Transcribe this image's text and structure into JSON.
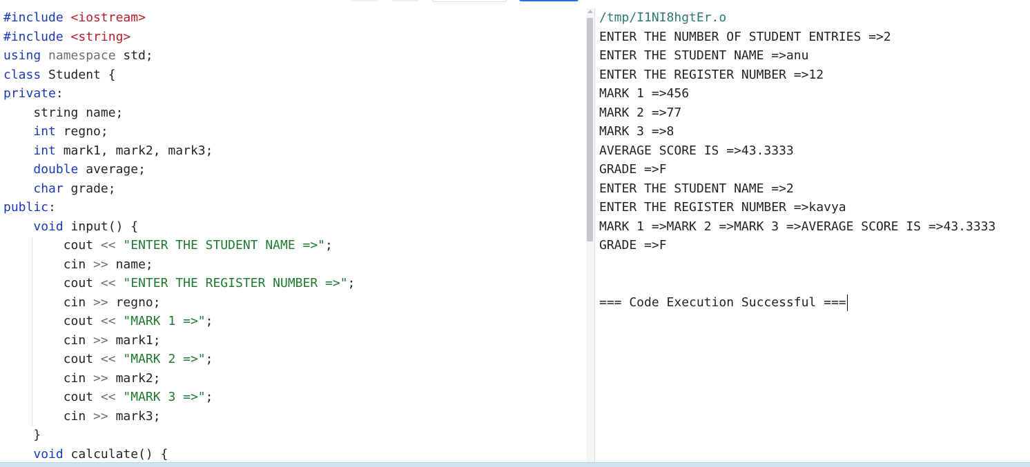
{
  "editor": {
    "lines": [
      [
        {
          "t": "#include ",
          "c": "inc"
        },
        {
          "t": "<iostream>",
          "c": "hdr"
        }
      ],
      [
        {
          "t": "#include ",
          "c": "inc"
        },
        {
          "t": "<string>",
          "c": "hdr"
        }
      ],
      [
        {
          "t": "using",
          "c": "kw"
        },
        {
          "t": " "
        },
        {
          "t": "namespace",
          "c": "ns"
        },
        {
          "t": " std;"
        }
      ],
      [
        {
          "t": "class",
          "c": "kw"
        },
        {
          "t": " Student {"
        }
      ],
      [
        {
          "t": "private",
          "c": "kw"
        },
        {
          "t": ":"
        }
      ],
      [
        {
          "t": "    string name;"
        }
      ],
      [
        {
          "t": "    "
        },
        {
          "t": "int",
          "c": "kw"
        },
        {
          "t": " regno;"
        }
      ],
      [
        {
          "t": "    "
        },
        {
          "t": "int",
          "c": "kw"
        },
        {
          "t": " mark1, mark2, mark3;"
        }
      ],
      [
        {
          "t": "    "
        },
        {
          "t": "double",
          "c": "kw"
        },
        {
          "t": " average;"
        }
      ],
      [
        {
          "t": "    "
        },
        {
          "t": "char",
          "c": "kw"
        },
        {
          "t": " grade;"
        }
      ],
      [
        {
          "t": "public",
          "c": "kw"
        },
        {
          "t": ":"
        }
      ],
      [
        {
          "t": "    "
        },
        {
          "t": "void",
          "c": "kw"
        },
        {
          "t": " input() {"
        }
      ],
      [
        {
          "t": "        cout "
        },
        {
          "t": "<<",
          "c": "op"
        },
        {
          "t": " "
        },
        {
          "t": "\"ENTER THE STUDENT NAME =>\"",
          "c": "str"
        },
        {
          "t": ";"
        }
      ],
      [
        {
          "t": "        cin "
        },
        {
          "t": ">>",
          "c": "op"
        },
        {
          "t": " name;"
        }
      ],
      [
        {
          "t": "        cout "
        },
        {
          "t": "<<",
          "c": "op"
        },
        {
          "t": " "
        },
        {
          "t": "\"ENTER THE REGISTER NUMBER =>\"",
          "c": "str"
        },
        {
          "t": ";"
        }
      ],
      [
        {
          "t": "        cin "
        },
        {
          "t": ">>",
          "c": "op"
        },
        {
          "t": " regno;"
        }
      ],
      [
        {
          "t": "        cout "
        },
        {
          "t": "<<",
          "c": "op"
        },
        {
          "t": " "
        },
        {
          "t": "\"MARK 1 =>\"",
          "c": "str"
        },
        {
          "t": ";"
        }
      ],
      [
        {
          "t": "        cin "
        },
        {
          "t": ">>",
          "c": "op"
        },
        {
          "t": " mark1;"
        }
      ],
      [
        {
          "t": "        cout "
        },
        {
          "t": "<<",
          "c": "op"
        },
        {
          "t": " "
        },
        {
          "t": "\"MARK 2 =>\"",
          "c": "str"
        },
        {
          "t": ";"
        }
      ],
      [
        {
          "t": "        cin "
        },
        {
          "t": ">>",
          "c": "op"
        },
        {
          "t": " mark2;"
        }
      ],
      [
        {
          "t": "        cout "
        },
        {
          "t": "<<",
          "c": "op"
        },
        {
          "t": " "
        },
        {
          "t": "\"MARK 3 =>\"",
          "c": "str"
        },
        {
          "t": ";"
        }
      ],
      [
        {
          "t": "        cin "
        },
        {
          "t": ">>",
          "c": "op"
        },
        {
          "t": " mark3;"
        }
      ],
      [
        {
          "t": "    }"
        }
      ],
      [
        {
          "t": "    "
        },
        {
          "t": "void",
          "c": "kw"
        },
        {
          "t": " calculate() {"
        }
      ]
    ]
  },
  "output": {
    "path": "/tmp/I1NI8hgtEr.o",
    "lines": [
      "ENTER THE NUMBER OF STUDENT ENTRIES =>2",
      "ENTER THE STUDENT NAME =>anu",
      "ENTER THE REGISTER NUMBER =>12",
      "MARK 1 =>456",
      "MARK 2 =>77",
      "MARK 3 =>8",
      "AVERAGE SCORE IS =>43.3333",
      "GRADE =>F",
      "ENTER THE STUDENT NAME =>2",
      "ENTER THE REGISTER NUMBER =>kavya",
      "MARK 1 =>MARK 2 =>MARK 3 =>AVERAGE SCORE IS =>43.3333",
      "GRADE =>F",
      "",
      "",
      "=== Code Execution Successful ==="
    ]
  },
  "colors": {
    "keyword": "#1a39b8",
    "header": "#b5202b",
    "string": "#1d7a2e",
    "path": "#2d7a6e",
    "run_button": "#1f6fe5"
  }
}
